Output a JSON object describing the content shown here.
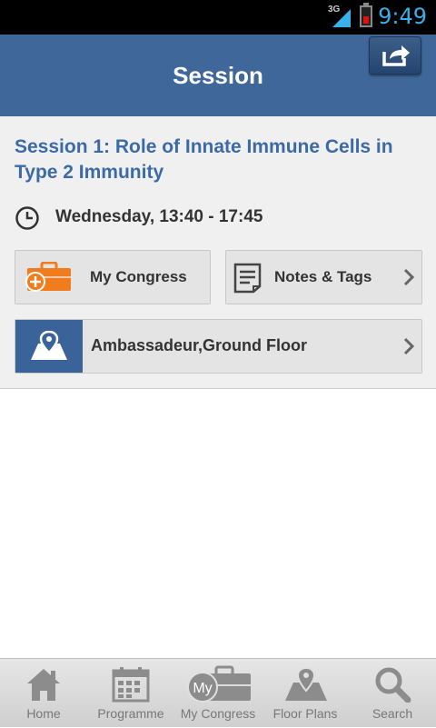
{
  "status_bar": {
    "network": "3G",
    "time": "9:49"
  },
  "header": {
    "title": "Session",
    "share_icon": "share-icon"
  },
  "session": {
    "title": "Session 1: Role of Innate Immune Cells in Type 2 Immunity",
    "time": "Wednesday, 13:40 - 17:45"
  },
  "actions": {
    "my_congress": "My Congress",
    "notes_tags": "Notes & Tags",
    "location": "Ambassadeur,Ground Floor"
  },
  "my_congress_badge": "My",
  "colors": {
    "header": "#3f6799",
    "title_text": "#3b6aa6",
    "accent_orange": "#f07c1e"
  },
  "tabs": [
    {
      "label": "Home",
      "icon": "home-icon"
    },
    {
      "label": "Programme",
      "icon": "calendar-icon"
    },
    {
      "label": "My Congress",
      "icon": "briefcase-icon"
    },
    {
      "label": "Floor Plans",
      "icon": "map-icon"
    },
    {
      "label": "Search",
      "icon": "search-icon"
    }
  ]
}
